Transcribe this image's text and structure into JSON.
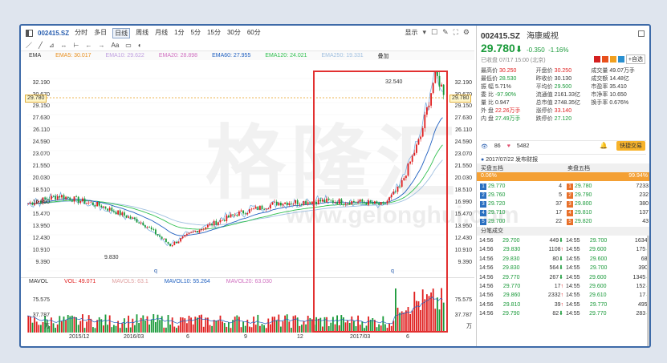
{
  "toolbar": {
    "symbol": "002415.SZ",
    "periods": [
      "分时",
      "多日",
      "日线",
      "周线",
      "月线",
      "1分",
      "5分",
      "15分",
      "30分",
      "60分"
    ],
    "active_period": "日线",
    "display_label": "显示"
  },
  "drawbar": {
    "tools": [
      "／",
      "╱",
      "⊿",
      "↔",
      "⊢",
      "←",
      "→",
      "Aa",
      "▭",
      "◐"
    ]
  },
  "ma_legend": [
    {
      "label": "EMA",
      "value": "",
      "color": "#333333"
    },
    {
      "label": "EMA5: 30.017",
      "value": "",
      "color": "#e89020"
    },
    {
      "label": "EMA10: 29.622",
      "value": "",
      "color": "#c0a0e0"
    },
    {
      "label": "EMA20: 28.898",
      "value": "",
      "color": "#d070c0"
    },
    {
      "label": "EMA60: 27.955",
      "value": "",
      "color": "#2060c0"
    },
    {
      "label": "EMA120: 24.021",
      "value": "",
      "color": "#30c050"
    },
    {
      "label": "EMA250: 19.331",
      "value": "",
      "color": "#a0c0e0"
    },
    {
      "label": "叠加",
      "value": "",
      "color": "#333333"
    }
  ],
  "yaxis_price": [
    "32.190",
    "30.670",
    "29.780",
    "29.150",
    "27.630",
    "26.110",
    "24.590",
    "23.070",
    "21.550",
    "20.030",
    "18.510",
    "16.990",
    "15.470",
    "13.950",
    "12.430",
    "10.910",
    "9.390"
  ],
  "current_price_tag": "29.780",
  "price_annotations": {
    "high": "32.540",
    "low": "9.830",
    "marker1": "q",
    "marker2": "q"
  },
  "vol_legend": [
    {
      "label": "MAVOL",
      "color": "#333333"
    },
    {
      "label": "VOL: 49.071",
      "color": "#e02020"
    },
    {
      "label": "MAVOL5: 63.1",
      "color": "#e0a0a0"
    },
    {
      "label": "MAVOL10: 55.264",
      "color": "#2060c0"
    },
    {
      "label": "MAVOL20: 63.030",
      "color": "#d070c0"
    }
  ],
  "yaxis_vol": [
    "75.575",
    "37.787",
    "万"
  ],
  "xaxis": [
    "2015/12",
    "2016/03",
    "6",
    "9",
    "12",
    "2017/03",
    "6"
  ],
  "watermark": "格隆汇",
  "watermark_url": "www.gelonghui.com",
  "quote": {
    "code": "002415.SZ",
    "name": "海康威视",
    "price": "29.780",
    "arrow": "⬇",
    "change": "-0.350",
    "change_pct": "-1.16%",
    "status": "已收盘 07/17 15:00 (北京)",
    "add_watch": "+自选"
  },
  "stats": [
    [
      {
        "label": "最高价",
        "value": "30.250",
        "color": "red"
      },
      {
        "label": "开盘价",
        "value": "30.250",
        "color": "red"
      },
      {
        "label": "成交量",
        "value": "49.07万手",
        "color": "black"
      }
    ],
    [
      {
        "label": "最低价",
        "value": "28.530",
        "color": "green"
      },
      {
        "label": "昨收价",
        "value": "30.130",
        "color": "black"
      },
      {
        "label": "成交额",
        "value": "14.48亿",
        "color": "black"
      }
    ],
    [
      {
        "label": "振 幅",
        "value": "5.71%",
        "color": "black"
      },
      {
        "label": "平均价",
        "value": "29.500",
        "color": "green"
      },
      {
        "label": "市盈率",
        "value": "35.410",
        "color": "black"
      }
    ],
    [
      {
        "label": "委 比",
        "value": "-97.90%",
        "color": "green"
      },
      {
        "label": "流通值",
        "value": "2161.33亿",
        "color": "black"
      },
      {
        "label": "市净率",
        "value": "10.650",
        "color": "black"
      }
    ],
    [
      {
        "label": "量 比",
        "value": "0.947",
        "color": "black"
      },
      {
        "label": "总市值",
        "value": "2748.35亿",
        "color": "black"
      },
      {
        "label": "换手率",
        "value": "0.676%",
        "color": "black"
      }
    ],
    [
      {
        "label": "外 盘",
        "value": "22.26万手",
        "color": "red"
      },
      {
        "label": "涨停价",
        "value": "33.140",
        "color": "red"
      },
      {
        "label": "",
        "value": "",
        "color": "black"
      }
    ],
    [
      {
        "label": "内 盘",
        "value": "27.49万手",
        "color": "green"
      },
      {
        "label": "跌停价",
        "value": "27.120",
        "color": "green"
      },
      {
        "label": "",
        "value": "",
        "color": "black"
      }
    ]
  ],
  "social": {
    "views": "86",
    "likes": "5482",
    "trade_label": "快捷交易"
  },
  "announcement": "2017/07/22 发布财报",
  "orderbook": {
    "buy_title": "买盘五档",
    "sell_title": "卖盘五档",
    "buy_pct": "0.06%",
    "sell_pct": "99.94%",
    "bids": [
      {
        "idx": "1",
        "price": "29.770",
        "vol": "4"
      },
      {
        "idx": "2",
        "price": "29.760",
        "vol": "5"
      },
      {
        "idx": "3",
        "price": "29.720",
        "vol": "37"
      },
      {
        "idx": "4",
        "price": "29.710",
        "vol": "17"
      },
      {
        "idx": "5",
        "price": "29.700",
        "vol": "22"
      }
    ],
    "asks": [
      {
        "idx": "1",
        "price": "29.780",
        "vol": "7233"
      },
      {
        "idx": "2",
        "price": "29.790",
        "vol": "232"
      },
      {
        "idx": "3",
        "price": "29.800",
        "vol": "380"
      },
      {
        "idx": "4",
        "price": "29.810",
        "vol": "137"
      },
      {
        "idx": "5",
        "price": "29.820",
        "vol": "43"
      }
    ]
  },
  "ticks_title": "分笔成交",
  "ticks": [
    [
      {
        "t": "14:56",
        "p": "29.700",
        "v": "449",
        "d": "down"
      },
      {
        "t": "14:55",
        "p": "29.700",
        "v": "1634",
        "d": "up"
      }
    ],
    [
      {
        "t": "14:56",
        "p": "29.830",
        "v": "1108",
        "d": "up"
      },
      {
        "t": "14:55",
        "p": "29.600",
        "v": "175",
        "d": "down"
      }
    ],
    [
      {
        "t": "14:56",
        "p": "29.830",
        "v": "80",
        "d": "down"
      },
      {
        "t": "14:55",
        "p": "29.600",
        "v": "68",
        "d": "up"
      }
    ],
    [
      {
        "t": "14:56",
        "p": "29.830",
        "v": "564",
        "d": "down"
      },
      {
        "t": "14:55",
        "p": "29.700",
        "v": "390",
        "d": "none"
      }
    ],
    [
      {
        "t": "14:56",
        "p": "29.770",
        "v": "267",
        "d": "down"
      },
      {
        "t": "14:55",
        "p": "29.600",
        "v": "1345",
        "d": "down"
      }
    ],
    [
      {
        "t": "14:56",
        "p": "29.770",
        "v": "17",
        "d": "up"
      },
      {
        "t": "14:55",
        "p": "29.600",
        "v": "152",
        "d": "down"
      }
    ],
    [
      {
        "t": "14:56",
        "p": "29.860",
        "v": "2332",
        "d": "up"
      },
      {
        "t": "14:55",
        "p": "29.610",
        "v": "17",
        "d": "down"
      }
    ],
    [
      {
        "t": "14:56",
        "p": "29.810",
        "v": "39",
        "d": "up"
      },
      {
        "t": "14:55",
        "p": "29.770",
        "v": "495",
        "d": "up"
      }
    ],
    [
      {
        "t": "14:56",
        "p": "29.790",
        "v": "82",
        "d": "down"
      },
      {
        "t": "14:55",
        "p": "29.770",
        "v": "283",
        "d": "down"
      }
    ]
  ]
}
